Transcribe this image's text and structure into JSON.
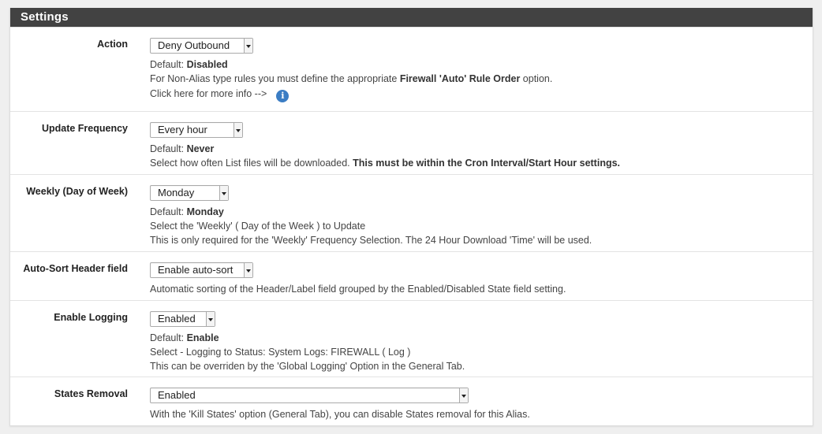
{
  "panel": {
    "title": "Settings"
  },
  "rows": [
    {
      "label": "Action",
      "select_value": "Deny Outbound",
      "default_prefix": "Default: ",
      "default_value": "Disabled",
      "line1_pre": "For Non-Alias type rules you must define the appropriate ",
      "line1_bold": "Firewall 'Auto' Rule Order",
      "line1_post": " option.",
      "line2": "Click here for more info -->",
      "info_icon": "info-icon"
    },
    {
      "label": "Update Frequency",
      "select_value": "Every hour",
      "default_prefix": "Default: ",
      "default_value": "Never",
      "line1_pre": "Select how often List files will be downloaded. ",
      "line1_bold": "This must be within the Cron Interval/Start Hour settings."
    },
    {
      "label": "Weekly (Day of Week)",
      "select_value": "Monday",
      "default_prefix": "Default: ",
      "default_value": "Monday",
      "line1": "Select the 'Weekly' ( Day of the Week ) to Update",
      "line2": "This is only required for the 'Weekly' Frequency Selection. The 24 Hour Download 'Time' will be used."
    },
    {
      "label": "Auto-Sort Header field",
      "select_value": "Enable auto-sort",
      "line1": "Automatic sorting of the Header/Label field grouped by the Enabled/Disabled State field setting."
    },
    {
      "label": "Enable Logging",
      "select_value": "Enabled",
      "default_prefix": "Default: ",
      "default_value": "Enable",
      "line1": "Select - Logging to Status: System Logs: FIREWALL ( Log )",
      "line2": "This can be overriden by the 'Global Logging' Option in the General Tab."
    },
    {
      "label": "States Removal",
      "select_value": "Enabled",
      "line1": "With the 'Kill States' option (General Tab), you can disable States removal for this Alias."
    }
  ]
}
